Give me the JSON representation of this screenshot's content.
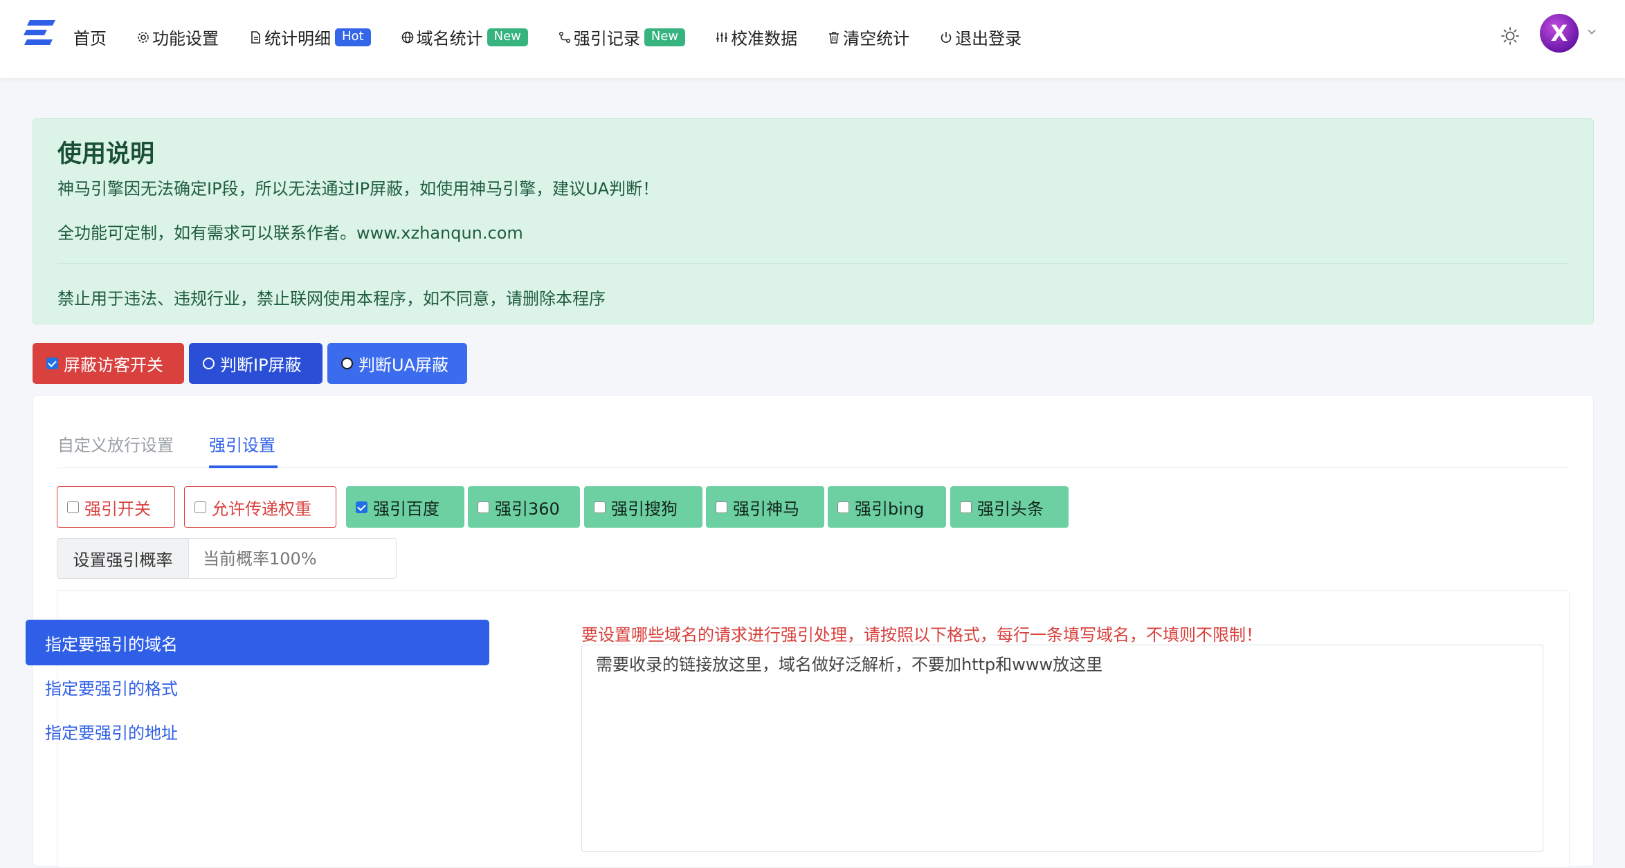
{
  "nav": {
    "home": "首页",
    "settings": "功能设置",
    "details": "统计明细",
    "details_badge": "Hot",
    "domain_stats": "域名统计",
    "domain_stats_badge": "New",
    "redirect_log": "强引记录",
    "redirect_log_badge": "New",
    "calibrate": "校准数据",
    "clear_stats": "清空统计",
    "logout": "退出登录",
    "avatar_letter": "X"
  },
  "notice": {
    "title": "使用说明",
    "line1": "神马引擎因无法确定IP段，所以无法通过IP屏蔽，如使用神马引擎，建议UA判断！",
    "line2": "全功能可定制，如有需求可以联系作者。www.xzhanqun.com",
    "line3": "禁止用于违法、违规行业，禁止联网使用本程序，如不同意，请删除本程序"
  },
  "toggles": {
    "block_visitors": "屏蔽访客开关",
    "block_visitors_checked": true,
    "ip_block": "判断IP屏蔽",
    "ua_block": "判断UA屏蔽"
  },
  "tabs": [
    "自定义放行设置",
    "强引设置"
  ],
  "active_tab": "强引设置",
  "options": [
    {
      "label": "强引开关",
      "checked": false,
      "style": "outline-danger"
    },
    {
      "label": "允许传递权重",
      "checked": false,
      "style": "outline-danger"
    },
    {
      "label": "强引百度",
      "checked": true,
      "style": "success"
    },
    {
      "label": "强引360",
      "checked": false,
      "style": "success"
    },
    {
      "label": "强引搜狗",
      "checked": false,
      "style": "success"
    },
    {
      "label": "强引神马",
      "checked": false,
      "style": "success"
    },
    {
      "label": "强引bing",
      "checked": false,
      "style": "success"
    },
    {
      "label": "强引头条",
      "checked": false,
      "style": "success"
    }
  ],
  "probability": {
    "label": "设置强引概率",
    "placeholder": "当前概率100%",
    "value": ""
  },
  "side_menu": [
    {
      "label": "指定要强引的域名",
      "active": true
    },
    {
      "label": "指定要强引的格式",
      "active": false
    },
    {
      "label": "指定要强引的地址",
      "active": false
    }
  ],
  "domain_hint": "要设置哪些域名的请求进行强引处理，请按照以下格式，每行一条填写域名，不填则不限制！",
  "domain_textarea": "需要收录的链接放这里，域名做好泛解析，不要加http和www放这里",
  "colors": {
    "primary": "#2f5fe6",
    "danger": "#d9413f",
    "success": "#6dd0a2",
    "notice_bg": "#dcf4e8"
  }
}
